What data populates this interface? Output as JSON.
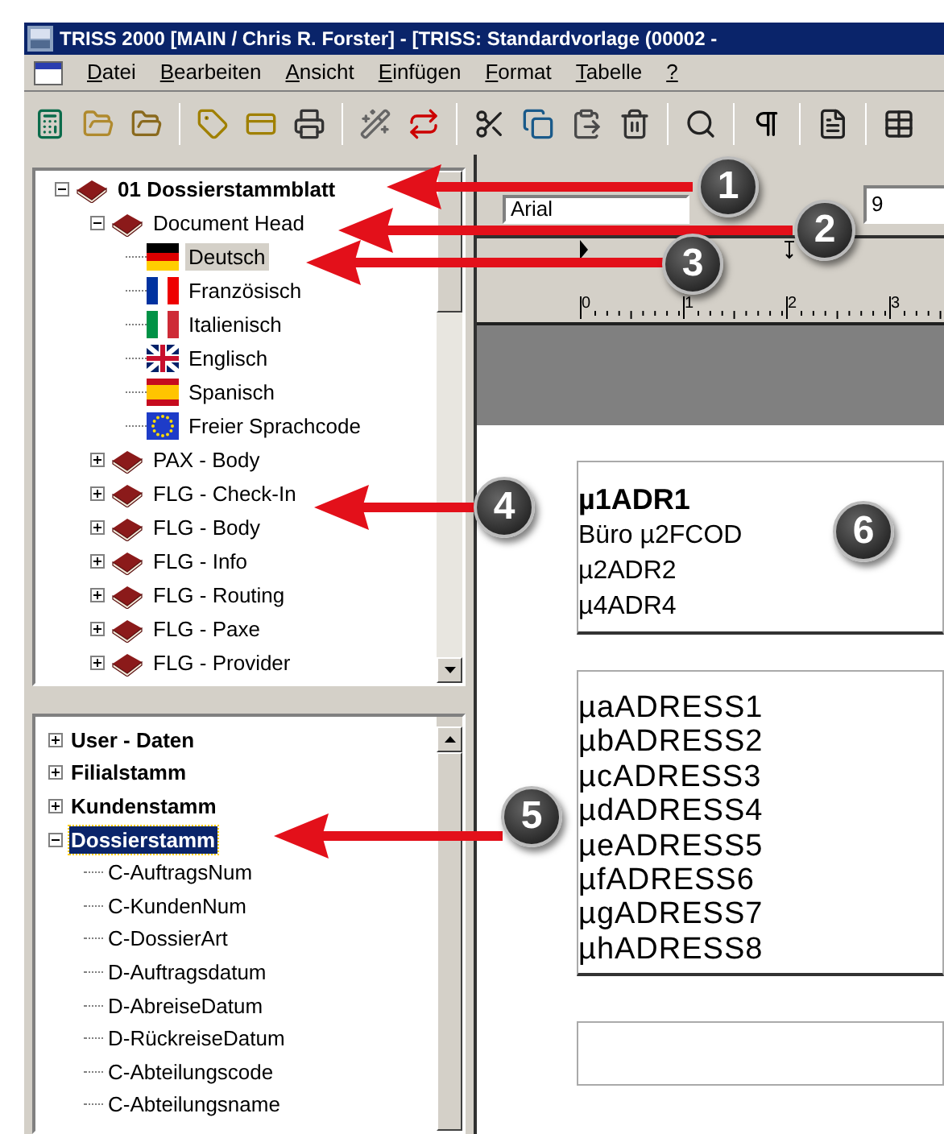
{
  "window": {
    "title": "TRISS 2000 [MAIN / Chris R. Forster] - [TRISS: Standardvorlage (00002 -"
  },
  "menu": [
    "Datei",
    "Bearbeiten",
    "Ansicht",
    "Einfügen",
    "Format",
    "Tabelle",
    "?"
  ],
  "section_tree": {
    "items": [
      {
        "label": "01 Dossierstammblatt",
        "kind": "chapter",
        "expanded": true,
        "selected": false,
        "children": [
          {
            "label": "Document Head",
            "kind": "chapter",
            "expanded": true,
            "selected": false,
            "children": [
              {
                "label": "Deutsch",
                "kind": "german",
                "selected": true
              },
              {
                "label": "Französisch",
                "kind": "french",
                "selected": false
              },
              {
                "label": "Italienisch",
                "kind": "italian",
                "selected": false
              },
              {
                "label": "Englisch",
                "kind": "british",
                "selected": false
              },
              {
                "label": "Spanisch",
                "kind": "spanish",
                "selected": false
              },
              {
                "label": "Freier Sprachcode",
                "kind": "european",
                "selected": false
              }
            ]
          },
          {
            "label": "PAX - Body",
            "kind": "chapter",
            "expanded": false,
            "selected": false
          },
          {
            "label": "FLG - Check-In",
            "kind": "chapter",
            "expanded": false,
            "selected": false
          },
          {
            "label": "FLG - Body",
            "kind": "chapter",
            "expanded": false,
            "selected": false
          },
          {
            "label": "FLG - Info",
            "kind": "chapter",
            "expanded": false,
            "selected": false
          },
          {
            "label": "FLG - Routing",
            "kind": "chapter",
            "expanded": false,
            "selected": false
          },
          {
            "label": "FLG - Paxe",
            "kind": "chapter",
            "expanded": false,
            "selected": false
          },
          {
            "label": "FLG - Provider",
            "kind": "chapter",
            "expanded": false,
            "selected": false
          }
        ]
      }
    ]
  },
  "field_tree": {
    "items": [
      {
        "label": "User - Daten",
        "expanded": false,
        "selected": false
      },
      {
        "label": "Filialstamm",
        "expanded": false,
        "selected": false
      },
      {
        "label": "Kundenstamm",
        "expanded": false,
        "selected": false
      },
      {
        "label": "Dossierstamm",
        "expanded": true,
        "selected": true,
        "children": [
          {
            "label": "C-AuftragsNum",
            "selected": false
          },
          {
            "label": "C-KundenNum",
            "selected": false
          },
          {
            "label": "C-DossierArt",
            "selected": false
          },
          {
            "label": "D-Auftragsdatum",
            "selected": false
          },
          {
            "label": "D-AbreiseDatum",
            "selected": false
          },
          {
            "label": "D-RückreiseDatum",
            "selected": false
          },
          {
            "label": "C-Abteilungscode",
            "selected": false
          },
          {
            "label": "C-Abteilungsname",
            "selected": false
          }
        ]
      }
    ]
  },
  "format_bar": {
    "font": "Arial",
    "size": "9"
  },
  "ruler": {
    "labels": [
      "0",
      "1",
      "2",
      "3"
    ]
  },
  "document": {
    "boxes": [
      {
        "lines": [
          {
            "text": "µ1ADR1",
            "kind": "title"
          },
          {
            "text": "Büro µ2FCOD",
            "kind": "text"
          },
          {
            "text": "µ2ADR2",
            "kind": "text"
          },
          {
            "text": "µ4ADR4",
            "kind": "text"
          }
        ]
      },
      {
        "lines": [
          {
            "text": "µaADRESS1",
            "kind": "field"
          },
          {
            "text": "µbADRESS2",
            "kind": "field"
          },
          {
            "text": "µcADRESS3",
            "kind": "field"
          },
          {
            "text": "µdADRESS4",
            "kind": "field"
          },
          {
            "text": "µeADRESS5",
            "kind": "field"
          },
          {
            "text": "µfADRESS6",
            "kind": "field"
          },
          {
            "text": "µgADRESS7",
            "kind": "field"
          },
          {
            "text": "µhADRESS8",
            "kind": "field"
          }
        ]
      }
    ]
  },
  "callouts": [
    {
      "number": "1"
    },
    {
      "number": "2"
    },
    {
      "number": "3"
    },
    {
      "number": "4"
    },
    {
      "number": "5"
    },
    {
      "number": "6"
    }
  ]
}
